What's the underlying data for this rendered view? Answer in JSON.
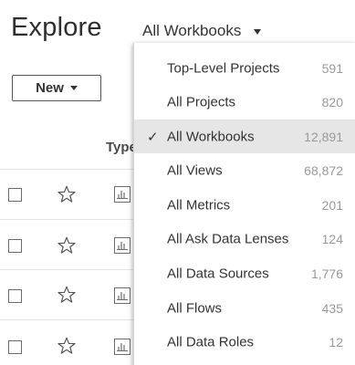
{
  "header": {
    "title": "Explore",
    "scope_selector": {
      "label": "All Workbooks",
      "icon": "caret-down-icon"
    }
  },
  "toolbar": {
    "new_button_label": "New",
    "new_button_icon": "caret-down-icon"
  },
  "table": {
    "columns": {
      "type_header": "Type"
    },
    "rows": [
      {
        "checked": false,
        "favorite": false,
        "type_icon": "workbook-chart-icon"
      },
      {
        "checked": false,
        "favorite": false,
        "type_icon": "workbook-chart-icon"
      },
      {
        "checked": false,
        "favorite": false,
        "type_icon": "workbook-chart-icon"
      },
      {
        "checked": false,
        "favorite": false,
        "type_icon": "workbook-chart-icon"
      }
    ]
  },
  "dropdown": {
    "items": [
      {
        "label": "Top-Level Projects",
        "count": "591",
        "selected": false
      },
      {
        "label": "All Projects",
        "count": "820",
        "selected": false
      },
      {
        "label": "All Workbooks",
        "count": "12,891",
        "selected": true
      },
      {
        "label": "All Views",
        "count": "68,872",
        "selected": false
      },
      {
        "label": "All Metrics",
        "count": "201",
        "selected": false
      },
      {
        "label": "All Ask Data Lenses",
        "count": "124",
        "selected": false
      },
      {
        "label": "All Data Sources",
        "count": "1,776",
        "selected": false
      },
      {
        "label": "All Flows",
        "count": "435",
        "selected": false
      },
      {
        "label": "All Data Roles",
        "count": "12",
        "selected": false
      }
    ],
    "check_glyph": "✓"
  },
  "colors": {
    "selected_background": "#e6e6e6",
    "text": "#333333",
    "count_text": "#9a9a9a"
  }
}
